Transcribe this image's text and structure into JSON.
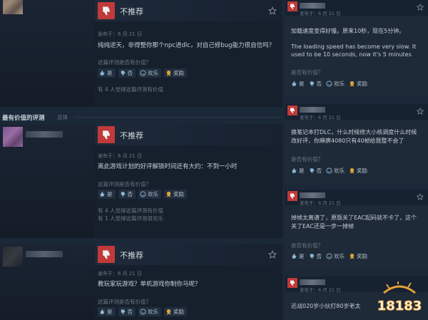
{
  "reviews": [
    {
      "verdict": "不推荐",
      "date": "发布于：6 月 21 日",
      "text": "纯纯逆天，非得整你那个npc进dlc，对自己修bug能力很自信吗？",
      "helpful_question": "这篇评测是否有价值？",
      "votes": {
        "yes": "是",
        "no": "否",
        "funny": "欢乐",
        "award": "奖励"
      },
      "stats": [
        "有 4 人觉得这篇评测有价值"
      ]
    },
    {
      "verdict": "不推荐",
      "date": "发布于：6 月 21 日",
      "text": "离此游戏计划的好评解锁时间还有大约：不到一小时",
      "helpful_question": "这篇评测是否有价值？",
      "votes": {
        "yes": "是",
        "no": "否",
        "funny": "欢乐",
        "award": "奖励"
      },
      "stats": [
        "有 4 人觉得这篇评测有价值",
        "有 1 人觉得这篇评测很欢乐"
      ]
    },
    {
      "verdict": "不推荐",
      "date": "发布于：6 月 21 日",
      "text": "教玩家玩游戏？单机游戏你制你马呢？",
      "helpful_question": "这篇评测是否有价值？",
      "votes": {
        "yes": "是",
        "no": "否",
        "funny": "欢乐",
        "award": "奖励"
      },
      "stats": []
    }
  ],
  "section": {
    "title": "最有价值的评测",
    "subtitle": "总体"
  },
  "right_reviews": [
    {
      "date": "发布于：6 月 21 日",
      "text_lines": [
        "加载速度变得好慢。原来10秒，现在5分钟。",
        "",
        "The loading speed has become very slow. It",
        "used to be 10 seconds, now it's 5 minutes"
      ],
      "helpful_question": "是否有价值？",
      "votes": {
        "yes": "是",
        "no": "否",
        "funny": "欢乐",
        "award": "奖励"
      }
    },
    {
      "date": "发布于：6 月 21 日",
      "text_lines": [
        "换笔记本打DLC，什么时候修大小核调度什么时候",
        "改好评，你麻痹4080只有40帧给我整不会了"
      ],
      "helpful_question": "是否有价值？",
      "votes": {
        "yes": "是",
        "no": "否",
        "funny": "欢乐",
        "award": "奖励"
      }
    },
    {
      "date": "发布于：6 月 21 日",
      "text_lines": [
        "掉帧太离谱了，原版关了EAC起码就不卡了，这个",
        "关了EAC还是一步一掉帧"
      ],
      "helpful_question": "是否有价值？",
      "votes": {
        "yes": "是",
        "no": "否",
        "funny": "欢乐",
        "award": "奖励"
      }
    },
    {
      "date": "发布于：6 月 21 日",
      "text_lines": [
        "近战020岁小伙打80岁老太"
      ],
      "helpful_question": "",
      "votes": null
    }
  ],
  "watermark": {
    "text": "18183"
  },
  "colors": {
    "negative": "#c03a3a",
    "award": "#e0a33a"
  }
}
